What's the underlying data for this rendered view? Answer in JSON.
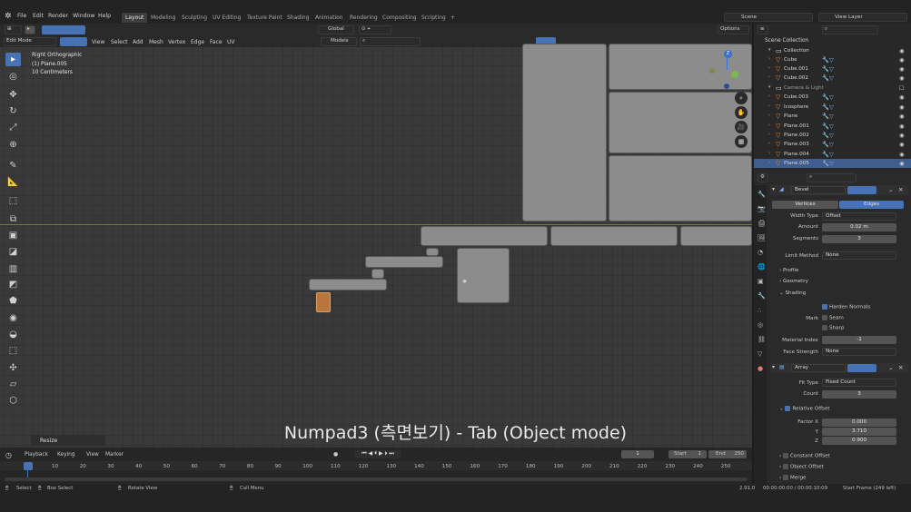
{
  "topbar": {
    "menus": [
      "File",
      "Edit",
      "Render",
      "Window",
      "Help"
    ],
    "workspaces": [
      "Layout",
      "Modeling",
      "Sculpting",
      "UV Editing",
      "Texture Paint",
      "Shading",
      "Animation",
      "Rendering",
      "Compositing",
      "Scripting"
    ],
    "add_tab": "+",
    "scene": "Scene",
    "view_layer": "View Layer"
  },
  "viewport_header": {
    "mode": "Edit Mode",
    "menus": [
      "View",
      "Select",
      "Add",
      "Mesh",
      "Vertex",
      "Edge",
      "Face",
      "UV"
    ],
    "transform_orientation": "Global",
    "snap_target": "Models",
    "options": "Options"
  },
  "viewport": {
    "view_name": "Right Orthographic",
    "object_name": "(1) Plane.005",
    "scale": "10 Centimeters",
    "gizmo_z": "Z",
    "last_operator": "Resize",
    "caption": "Numpad3 (측면보기) - Tab (Object mode)"
  },
  "outliner": {
    "root": "Scene Collection",
    "rows": [
      {
        "name": "Collection",
        "type": "collection"
      },
      {
        "name": "Cube",
        "type": "mesh"
      },
      {
        "name": "Cube.001",
        "type": "mesh"
      },
      {
        "name": "Cube.002",
        "type": "mesh"
      },
      {
        "name": "Camera & Light",
        "type": "collection"
      },
      {
        "name": "Cube.003",
        "type": "mesh"
      },
      {
        "name": "Icosphere",
        "type": "mesh"
      },
      {
        "name": "Plane",
        "type": "mesh"
      },
      {
        "name": "Plane.001",
        "type": "mesh"
      },
      {
        "name": "Plane.002",
        "type": "mesh"
      },
      {
        "name": "Plane.003",
        "type": "mesh"
      },
      {
        "name": "Plane.004",
        "type": "mesh"
      },
      {
        "name": "Plane.005",
        "type": "mesh",
        "selected": true
      }
    ]
  },
  "properties": {
    "bevel": {
      "name": "Bevel",
      "affect_vertices": "Vertices",
      "affect_edges": "Edges",
      "width_type_label": "Width Type",
      "width_type": "Offset",
      "amount_label": "Amount",
      "amount": "0.02 m",
      "segments_label": "Segments",
      "segments": "3",
      "limit_method_label": "Limit Method",
      "limit_method": "None",
      "profile": "Profile",
      "geometry": "Geometry",
      "shading": "Shading",
      "harden_normals": "Harden Normals",
      "mark_label": "Mark",
      "seam": "Seam",
      "sharp": "Sharp",
      "material_index_label": "Material Index",
      "material_index": "-1",
      "face_strength_label": "Face Strength",
      "face_strength": "None"
    },
    "array": {
      "name": "Array",
      "fit_type_label": "Fit Type",
      "fit_type": "Fixed Count",
      "count_label": "Count",
      "count": "3",
      "relative_offset": "Relative Offset",
      "factor_x_label": "Factor X",
      "factor_x": "0.000",
      "y_label": "Y",
      "factor_y": "3.710",
      "z_label": "Z",
      "factor_z": "0.900",
      "constant_offset": "Constant Offset",
      "object_offset": "Object Offset",
      "merge": "Merge"
    }
  },
  "timeline": {
    "menus": [
      "Playback",
      "Keying",
      "View",
      "Marker"
    ],
    "current_frame": "1",
    "start_label": "Start",
    "start": "1",
    "end_label": "End",
    "end": "250",
    "ticks": [
      "1",
      "10",
      "20",
      "30",
      "40",
      "50",
      "60",
      "70",
      "80",
      "90",
      "100",
      "110",
      "120",
      "130",
      "140",
      "150",
      "160",
      "170",
      "180",
      "190",
      "200",
      "210",
      "220",
      "230",
      "240",
      "250"
    ]
  },
  "statusbar": {
    "select": "Select",
    "box_select": "Box Select",
    "rotate_view": "Rotate View",
    "call_menu": "Call Menu",
    "version": "2.91.0",
    "time": "00:00:00:00 / 00:00:10:09",
    "start_frame": "Start Frame (249 left)"
  },
  "colors": {
    "accent": "#4772b3",
    "selected_row": "#3f5d8e",
    "active_object": "#e08a3a",
    "mesh_mod": "#7fb0f0"
  }
}
